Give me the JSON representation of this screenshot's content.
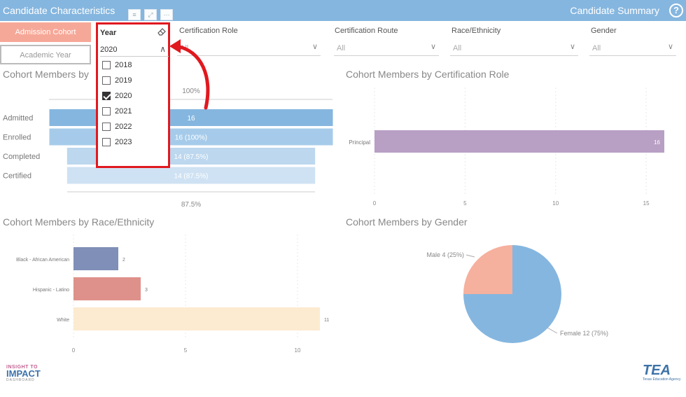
{
  "header": {
    "title": "Candidate Characteristics",
    "summary_link": "Candidate Summary",
    "help_icon": "question-circle-icon"
  },
  "tabs": {
    "admission": "Admission Cohort",
    "academic": "Academic Year"
  },
  "filters": {
    "year": {
      "label": "Year",
      "value": "2020",
      "options": [
        "2018",
        "2019",
        "2020",
        "2021",
        "2022",
        "2023"
      ],
      "checked": "2020"
    },
    "certification_role": {
      "label": "Certification Role",
      "value": "All"
    },
    "certification_route": {
      "label": "Certification Route",
      "value": "All"
    },
    "race_ethnicity": {
      "label": "Race/Ethnicity",
      "value": "All"
    },
    "gender": {
      "label": "Gender",
      "value": "All"
    }
  },
  "panels": {
    "cohort": "Cohort Members by",
    "cert_role": "Cohort Members by Certification Role",
    "race": "Cohort Members by Race/Ethnicity",
    "gender": "Cohort Members by Gender"
  },
  "chart_data": [
    {
      "type": "bar",
      "title": "Cohort Members by",
      "categories": [
        "Admitted",
        "Enrolled",
        "Completed",
        "Certified"
      ],
      "values": [
        16,
        16,
        14,
        14
      ],
      "labels": [
        "16",
        "16 (100%)",
        "14 (87.5%)",
        "14 (87.5%)"
      ],
      "top_pct": "100%",
      "bottom_pct": "87.5%",
      "colors": [
        "#85b6df",
        "#a6cbea",
        "#bcd7ee",
        "#cfe2f3"
      ]
    },
    {
      "type": "bar",
      "title": "Cohort Members by Certification Role",
      "categories": [
        "Principal"
      ],
      "values": [
        16
      ],
      "x_ticks": [
        "0",
        "5",
        "10",
        "15"
      ],
      "xlim": [
        0,
        16
      ],
      "color": "#b89fc4"
    },
    {
      "type": "bar",
      "title": "Cohort Members by Race/Ethnicity",
      "categories": [
        "Black - African American",
        "Hispanic - Latino",
        "White"
      ],
      "values": [
        2,
        3,
        11
      ],
      "x_ticks": [
        "0",
        "5",
        "10"
      ],
      "xlim": [
        0,
        11
      ],
      "colors": [
        "#7f8fb7",
        "#de918a",
        "#fcebd0"
      ]
    },
    {
      "type": "pie",
      "title": "Cohort Members by Gender",
      "slices": [
        {
          "label": "Female 12 (75%)",
          "value": 12,
          "color": "#85b6df"
        },
        {
          "label": "Male 4 (25%)",
          "value": 4,
          "color": "#f6b09e"
        }
      ]
    }
  ],
  "footer": {
    "logo_left_top": "INSIGHT TO",
    "logo_left_main": "IMPACT",
    "logo_left_sub": "DASHBOARD",
    "logo_right": "TEA",
    "logo_right_sub": "Texas Education Agency"
  }
}
